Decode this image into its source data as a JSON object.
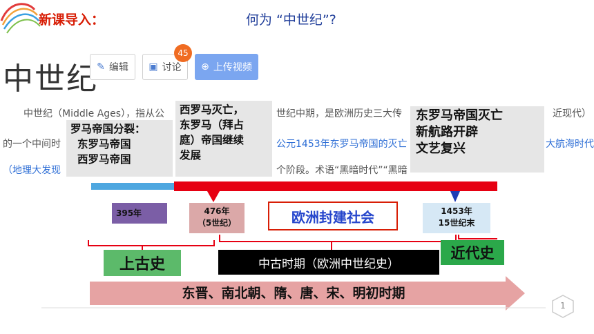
{
  "header": {
    "lead_label": "新课导入：",
    "question": "何为 “中世纪”?"
  },
  "screenshot": {
    "title": "中世纪",
    "buttons": {
      "edit": "编辑",
      "discuss": "讨论",
      "discuss_count": "45",
      "upload": "上传视频"
    },
    "body_lines": [
      "中世纪（Middle Ages），指从公",
      "世纪中期，是欧洲历史三大传",
      "近现代）",
      "的一个中间时",
      "公元1453年东罗马帝国的灭亡",
      "大航海时代",
      "（地理大发现",
      "个阶段。术语“黑暗时代”“黑暗"
    ]
  },
  "notes": {
    "split": [
      "罗马帝国分裂：",
      "东罗马帝国",
      "西罗马帝国"
    ],
    "west": [
      "西罗马灭亡，",
      "东罗马（拜占",
      "庭）帝国继续",
      "发展"
    ],
    "east": [
      "东罗马帝国灭亡",
      "新航路开辟",
      "文艺复兴"
    ]
  },
  "timeline": {
    "t395": "395年",
    "t476_a": "476年",
    "t476_b": "（5世纪）",
    "t1453_a": "1453年",
    "t1453_b": "15世纪末",
    "feudal": "欧洲封建社会"
  },
  "periods": {
    "ancient": "上古史",
    "medieval": "中古时期（欧洲中世纪史）",
    "modern": "近代史"
  },
  "china_arrow": "东晋、南北朝、隋、唐、宋、明初时期",
  "page_number": "1",
  "colors": {
    "red": "#e60012",
    "blue_bar": "#4ea7e0",
    "arrow_pink": "#e6a3a3",
    "title_red": "#d81e06"
  }
}
